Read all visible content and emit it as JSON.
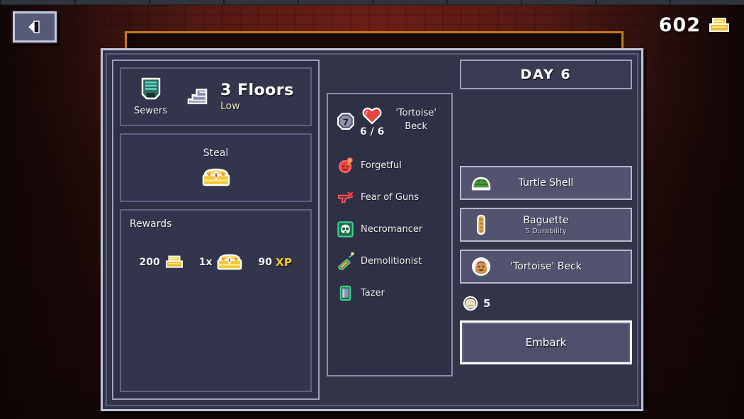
{
  "header": {
    "back_button_label": "Back",
    "back_icon": "left-arrow-icon",
    "gold_amount": "602",
    "gold_icon": "gold-bars-icon"
  },
  "dungeon": {
    "icon": "sewers-door-icon",
    "name": "Sewers",
    "floors_icon": "stairs-icon",
    "floors": "3 Floors",
    "difficulty": "Low"
  },
  "objective": {
    "title": "Steal",
    "icon": "treasure-chest-icon"
  },
  "rewards": {
    "label": "Rewards",
    "items": [
      {
        "qty": "200",
        "icon": "gold-bars-icon",
        "name": "gold"
      },
      {
        "qty": "1x",
        "icon": "treasure-chest-icon",
        "name": "chest"
      },
      {
        "qty": "90",
        "icon": "xp-icon",
        "name": "XP",
        "tag": "XP"
      }
    ]
  },
  "hero": {
    "level": "7",
    "hp_icon": "heart-icon",
    "hp": "6 / 6",
    "name": "'Tortoise'\nBeck",
    "name_line1": "'Tortoise'",
    "name_line2": "Beck",
    "traits": [
      {
        "label": "Forgetful",
        "icon": "forgetful-head-icon",
        "color": "#e8434f"
      },
      {
        "label": "Fear of Guns",
        "icon": "crossed-gun-icon",
        "color": "#e8434f"
      },
      {
        "label": "Necromancer",
        "icon": "skull-icon",
        "color": "#3fd08a"
      },
      {
        "label": "Demolitionist",
        "icon": "dynamite-icon",
        "color": "#3fd08a"
      },
      {
        "label": "Tazer",
        "icon": "tazer-icon",
        "color": "#3fd08a"
      }
    ]
  },
  "run": {
    "day_label": "DAY 6",
    "loadout": [
      {
        "name": "Turtle Shell",
        "sub": "",
        "icon": "turtle-shell-icon"
      },
      {
        "name": "Baguette",
        "sub": "5 Durability",
        "icon": "baguette-icon"
      },
      {
        "name": "'Tortoise' Beck",
        "sub": "",
        "icon": "hero-portrait-icon"
      }
    ],
    "rations_icon": "ration-bread-icon",
    "rations_count": "5",
    "embark_label": "Embark"
  },
  "colors": {
    "panel_bg": "#32354a",
    "panel_border": "#c3c6d8",
    "sub_panel_bg": "#32354c",
    "accent_orange": "#c77a18",
    "xp_yellow": "#f5c723",
    "difficulty_yellow": "#e8e2b4",
    "trait_bad": "#e8434f",
    "trait_good": "#3fd08a",
    "background_red": "#541a13"
  }
}
